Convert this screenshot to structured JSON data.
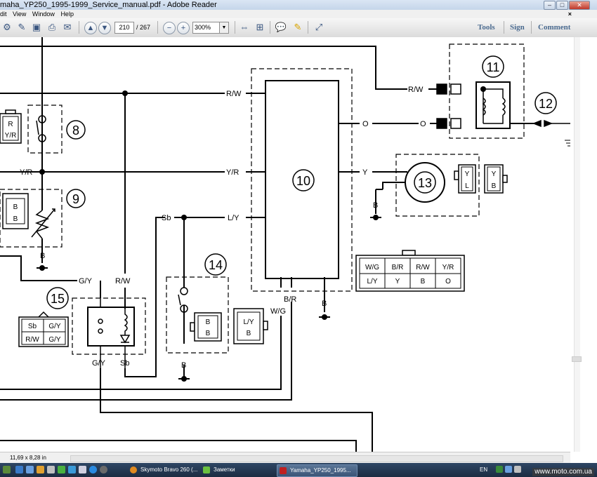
{
  "window": {
    "title": "maha_YP250_1995-1999_Service_manual.pdf - Adobe Reader"
  },
  "menu": {
    "items": [
      "dit",
      "View",
      "Window",
      "Help"
    ]
  },
  "toolbar": {
    "current_page": "210",
    "total_pages": "/ 267",
    "zoom": "300%",
    "tools_label": "Tools",
    "sign_label": "Sign",
    "comment_label": "Comment"
  },
  "diagram": {
    "numbers": {
      "n8": "8",
      "n9": "9",
      "n10": "10",
      "n11": "11",
      "n12": "12",
      "n13": "13",
      "n14": "14",
      "n15": "15"
    },
    "wire_labels": {
      "rw_top": "R/W",
      "rw_11": "R/W",
      "o_left": "O",
      "o_right": "O",
      "yr_left": "Y/R",
      "yr_mid": "Y/R",
      "y_13": "Y",
      "ly": "L/Y",
      "sb_mid": "Sb",
      "gy_top": "G/Y",
      "rw_15": "R/W",
      "gy_bottom": "G/Y",
      "sb_bottom": "Sb",
      "br": "B/R",
      "wg": "W/G",
      "b_9": "B",
      "b_13": "B",
      "b_10": "B",
      "b_14": "B"
    },
    "connector8": [
      "R",
      "Y/R"
    ],
    "connector9": [
      "B",
      "B"
    ],
    "connector13_a": [
      "Y",
      "L"
    ],
    "connector13_b": [
      "Y",
      "B"
    ],
    "connector14_a": [
      "B",
      "B"
    ],
    "connector14_b": [
      "L/Y",
      "B"
    ],
    "connector15": [
      "Sb",
      "G/Y",
      "R/W",
      "G/Y"
    ],
    "connector10": [
      "W/G",
      "B/R",
      "R/W",
      "Y/R",
      "L/Y",
      "Y",
      "B",
      "O"
    ]
  },
  "status": {
    "page_size": "11,69 x 8,28 in"
  },
  "taskbar": {
    "task1": "Skymoto Bravo 260 (...",
    "task2": "Заметки",
    "task3": "Yamaha_YP250_1995...",
    "lang": "EN"
  },
  "watermark": "www.moto.com.ua"
}
